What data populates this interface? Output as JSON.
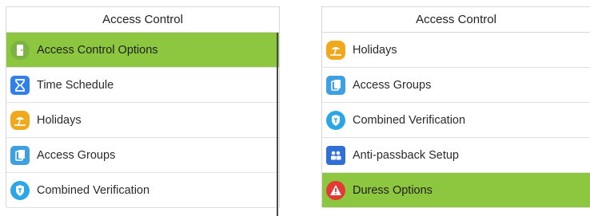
{
  "left_panel": {
    "title": "Access Control",
    "items": [
      {
        "label": "Access Control Options",
        "icon": "door-icon",
        "icon_color": "#7cb342",
        "selected": true
      },
      {
        "label": "Time Schedule",
        "icon": "hourglass-icon",
        "icon_color": "#2f80ed",
        "selected": false
      },
      {
        "label": "Holidays",
        "icon": "beach-icon",
        "icon_color": "#f0a81c",
        "selected": false
      },
      {
        "label": "Access Groups",
        "icon": "copy-icon",
        "icon_color": "#3ea0e0",
        "selected": false
      },
      {
        "label": "Combined Verification",
        "icon": "shield-icon",
        "icon_color": "#2ba7e6",
        "selected": false
      }
    ]
  },
  "right_panel": {
    "title": "Access Control",
    "items": [
      {
        "label": "Holidays",
        "icon": "beach-icon",
        "icon_color": "#f0a81c",
        "selected": false
      },
      {
        "label": "Access Groups",
        "icon": "copy-icon",
        "icon_color": "#3ea0e0",
        "selected": false
      },
      {
        "label": "Combined Verification",
        "icon": "shield-icon",
        "icon_color": "#2ba7e6",
        "selected": false
      },
      {
        "label": "Anti-passback Setup",
        "icon": "users-icon",
        "icon_color": "#2f6fd6",
        "selected": false
      },
      {
        "label": "Duress Options",
        "icon": "warning-icon",
        "icon_color": "#e53935",
        "selected": true
      }
    ]
  },
  "colors": {
    "selected_bg": "#8dc63f",
    "divider": "#e2e2e2"
  }
}
